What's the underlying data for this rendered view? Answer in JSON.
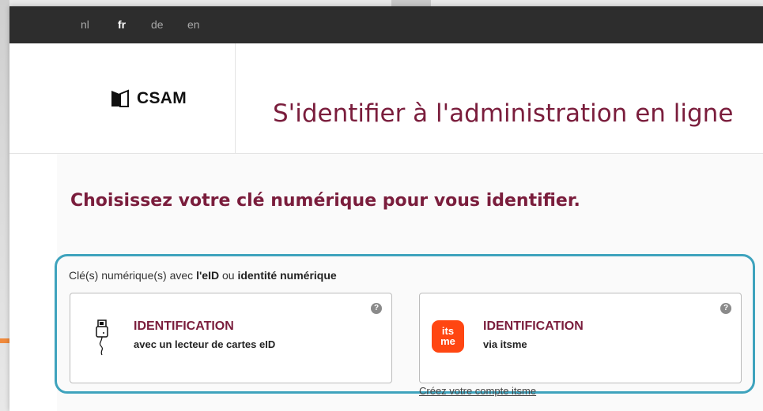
{
  "languages": [
    {
      "code": "nl",
      "active": false
    },
    {
      "code": "fr",
      "active": true
    },
    {
      "code": "de",
      "active": false
    },
    {
      "code": "en",
      "active": false
    }
  ],
  "header": {
    "logo_text": "CSAM",
    "title": "S'identifier à l'administration en ligne"
  },
  "content": {
    "choose_title": "Choisissez votre clé numérique pour vous identifier.",
    "section": {
      "label_prefix": "Clé(s) numérique(s) avec ",
      "label_bold_1": "l'eID",
      "label_middle": " ou ",
      "label_bold_2": "identité numérique"
    },
    "cards": [
      {
        "title": "IDENTIFICATION",
        "subtitle": "avec un lecteur de cartes eID",
        "icon": "card-reader-icon",
        "help": "?"
      },
      {
        "title": "IDENTIFICATION",
        "subtitle": "via itsme",
        "icon": "itsme-logo-icon",
        "icon_text_1": "its",
        "icon_text_2": "me",
        "help": "?"
      }
    ],
    "create_account_link": "Créez votre compte itsme"
  },
  "colors": {
    "brand": "#7a1d3c",
    "highlight_border": "#3ea3bd",
    "arrow": "#f08a3c",
    "itsme": "#ff4612",
    "lang_bar": "#2d2d2d"
  }
}
